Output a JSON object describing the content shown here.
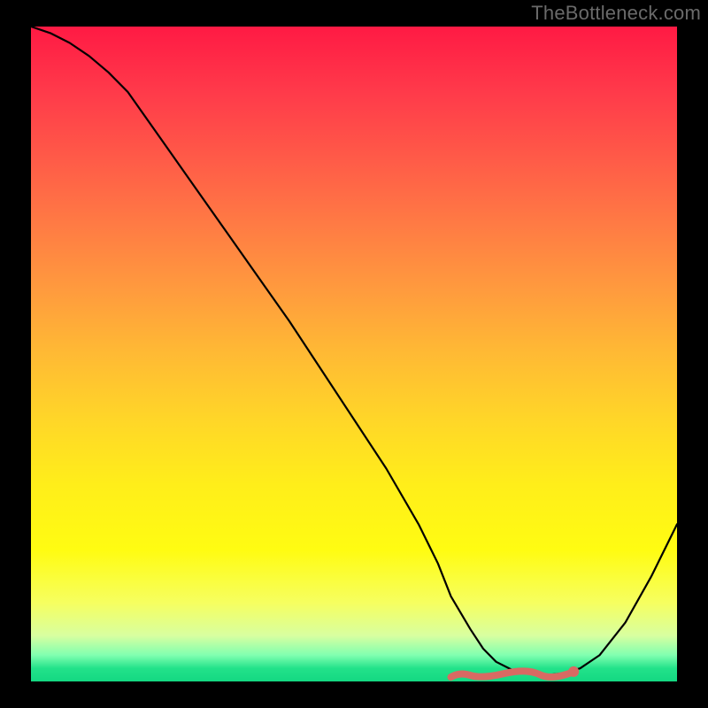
{
  "watermark": "TheBottleneck.com",
  "colors": {
    "background": "#000000",
    "curve": "#000000",
    "band": "#d86a63",
    "gradient_top": "#ff1a44",
    "gradient_bottom": "#14d882"
  },
  "chart_data": {
    "type": "line",
    "title": "",
    "xlabel": "",
    "ylabel": "",
    "xlim": [
      0,
      100
    ],
    "ylim": [
      0,
      100
    ],
    "grid": false,
    "legend": false,
    "series": [
      {
        "name": "curve",
        "x": [
          0,
          3,
          6,
          9,
          12,
          15,
          20,
          25,
          30,
          35,
          40,
          45,
          50,
          55,
          60,
          63,
          65,
          68,
          70,
          72,
          75,
          78,
          80,
          82,
          85,
          88,
          92,
          96,
          100
        ],
        "y": [
          100,
          99,
          97.5,
          95.5,
          93,
          90,
          83,
          76,
          69,
          62,
          55,
          47.5,
          40,
          32.5,
          24,
          18,
          13,
          8,
          5,
          3,
          1.5,
          1,
          1,
          1.2,
          2,
          4,
          9,
          16,
          24
        ]
      }
    ],
    "optimal_band": {
      "x_start": 65,
      "x_end": 84,
      "y": 1.2
    },
    "annotations": [
      {
        "type": "point",
        "x": 84,
        "y": 1.5,
        "color": "#d86a63"
      }
    ]
  }
}
